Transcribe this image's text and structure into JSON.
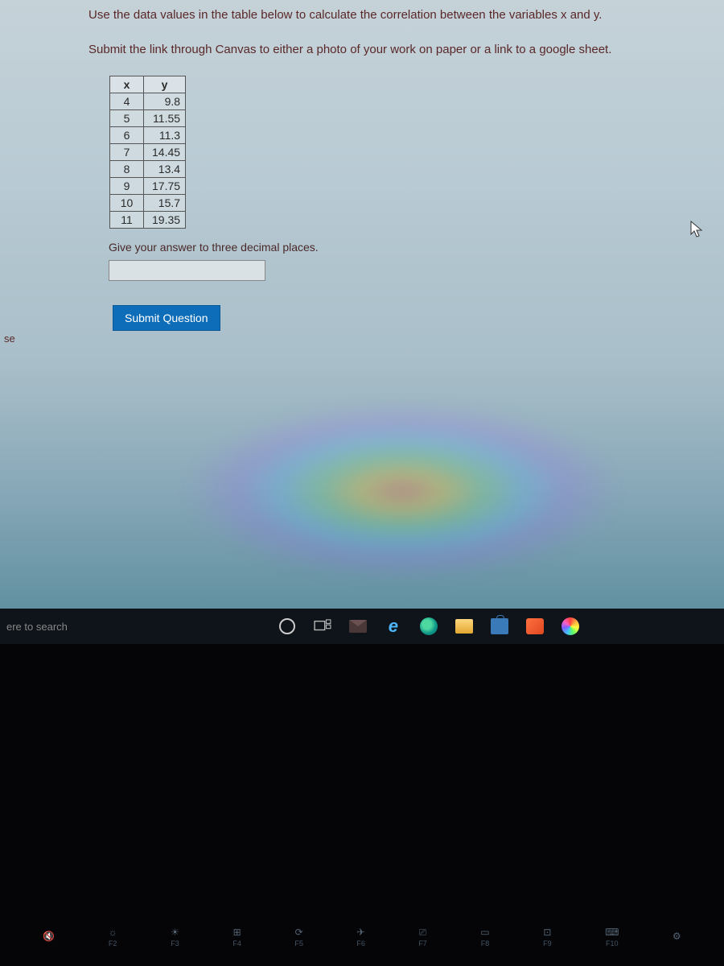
{
  "question": {
    "line1": "Use the data values in the table below to calculate the correlation between the variables x and y.",
    "line2": "Submit the link through Canvas to either a photo of your work on paper or a link to a google sheet.",
    "table_header_x": "x",
    "table_header_y": "y",
    "rows": [
      {
        "x": "4",
        "y": "9.8"
      },
      {
        "x": "5",
        "y": "11.55"
      },
      {
        "x": "6",
        "y": "11.3"
      },
      {
        "x": "7",
        "y": "14.45"
      },
      {
        "x": "8",
        "y": "13.4"
      },
      {
        "x": "9",
        "y": "17.75"
      },
      {
        "x": "10",
        "y": "15.7"
      },
      {
        "x": "11",
        "y": "19.35"
      }
    ],
    "prompt": "Give your answer to three decimal places.",
    "answer_value": "",
    "submit_label": "Submit Question"
  },
  "left_tab": "se",
  "taskbar": {
    "search_placeholder": "ere to search"
  },
  "fn_keys": [
    "F2",
    "F3",
    "F4",
    "F5",
    "F6",
    "F7",
    "F8",
    "F9",
    "F10"
  ],
  "chart_data": {
    "type": "table",
    "title": "Correlation data (x vs y)",
    "columns": [
      "x",
      "y"
    ],
    "rows": [
      [
        4,
        9.8
      ],
      [
        5,
        11.55
      ],
      [
        6,
        11.3
      ],
      [
        7,
        14.45
      ],
      [
        8,
        13.4
      ],
      [
        9,
        17.75
      ],
      [
        10,
        15.7
      ],
      [
        11,
        19.35
      ]
    ]
  }
}
